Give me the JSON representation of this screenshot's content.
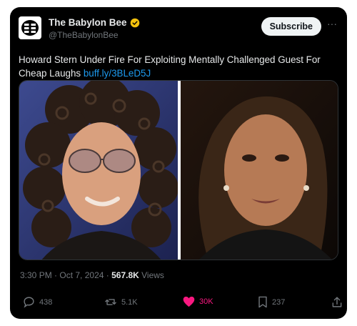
{
  "account": {
    "display_name": "The Babylon Bee",
    "handle": "@TheBabylonBee",
    "verified_color": "#f4c20d"
  },
  "subscribe_label": "Subscribe",
  "more_label": "···",
  "tweet": {
    "text": "Howard Stern Under Fire For Exploiting Mentally Challenged Guest For Cheap Laughs",
    "link": "buff.ly/3BLeD5J"
  },
  "media": {
    "alt_left": "Photo of Howard Stern",
    "alt_right": "Photo of Kamala Harris"
  },
  "meta": {
    "time": "3:30 PM",
    "separator": " · ",
    "date": "Oct 7, 2024",
    "separator2": " · ",
    "views_count": "567.8K",
    "views_label": "Views"
  },
  "actions": {
    "replies": "438",
    "reposts": "5.1K",
    "likes": "30K",
    "bookmarks": "237",
    "liked_color": "#f91880",
    "muted_color": "#71767b"
  },
  "icons": {
    "avatar": "babylon-bee-logo-icon",
    "verified": "verified-badge-icon",
    "reply": "reply-icon",
    "repost": "repost-icon",
    "like": "heart-icon",
    "bookmark": "bookmark-icon",
    "share": "share-icon"
  }
}
